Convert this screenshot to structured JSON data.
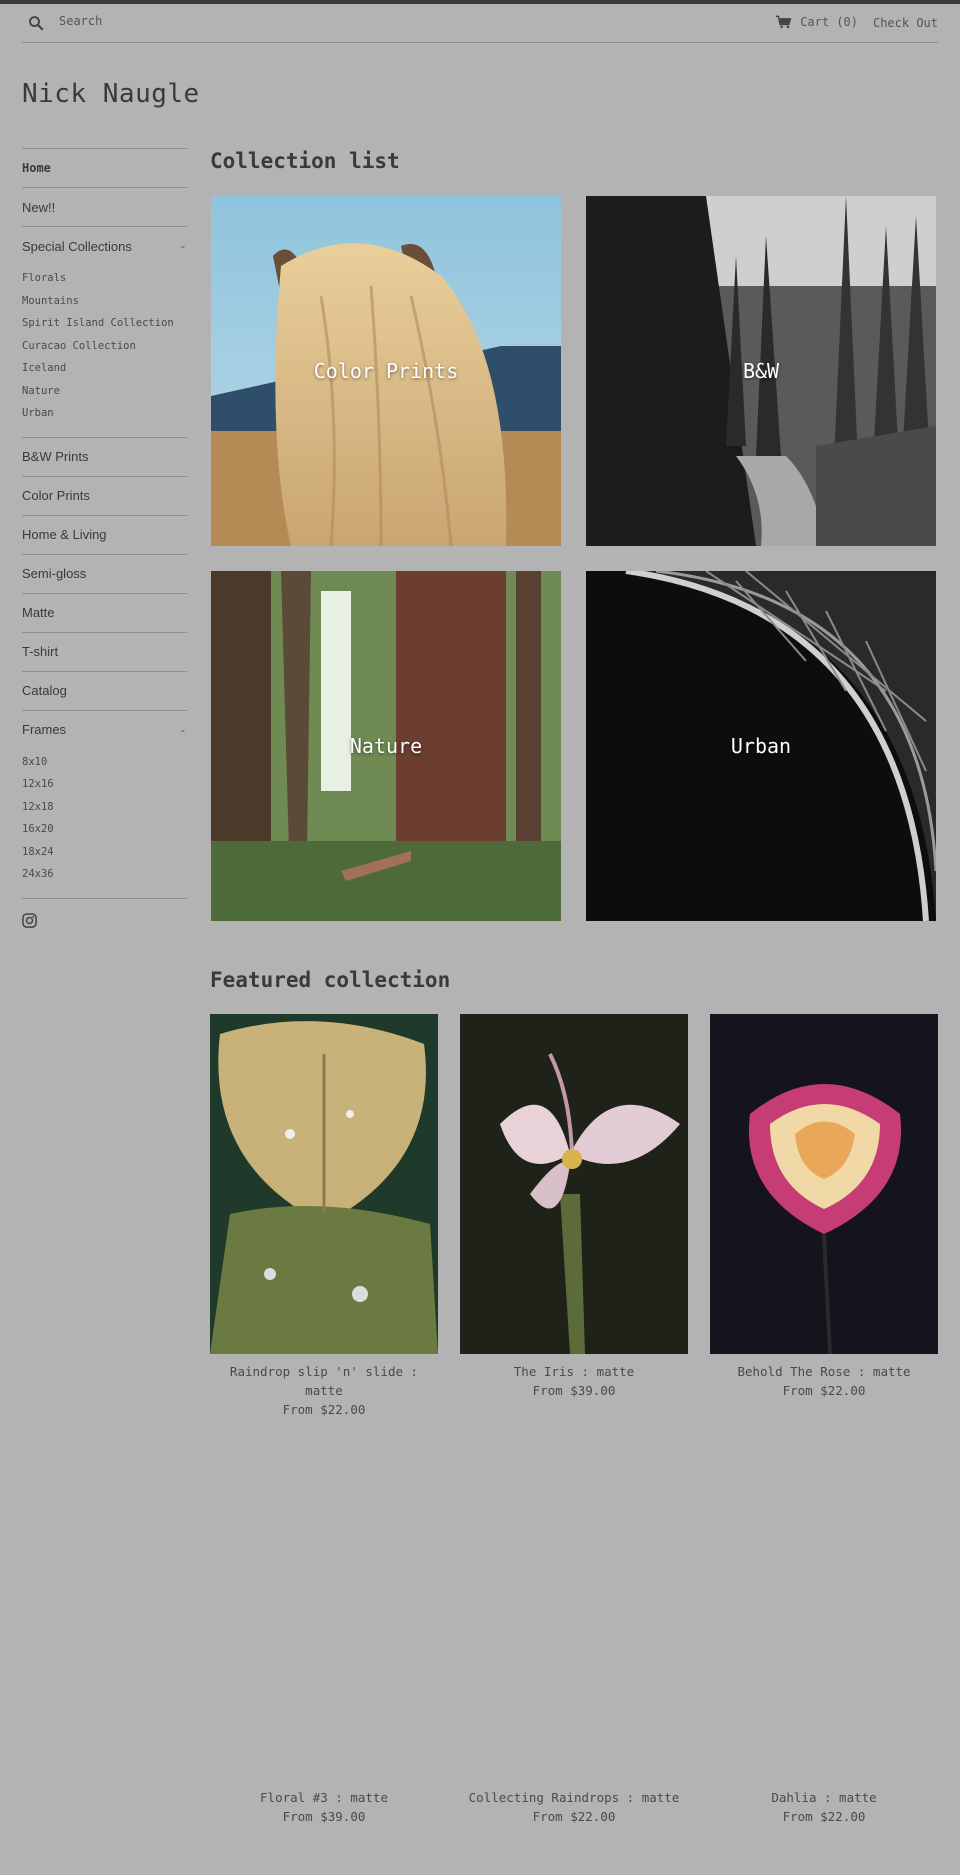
{
  "header": {
    "search_placeholder": "Search",
    "cart_label": "Cart (0)",
    "checkout_label": "Check Out"
  },
  "site": {
    "title": "Nick Naugle"
  },
  "sidebar": {
    "items": [
      {
        "label": "Home"
      },
      {
        "label": "New!!"
      },
      {
        "label": "Special Collections",
        "toggle": "-"
      },
      {
        "label": "B&W Prints"
      },
      {
        "label": "Color Prints"
      },
      {
        "label": "Home & Living"
      },
      {
        "label": "Semi-gloss"
      },
      {
        "label": "Matte"
      },
      {
        "label": "T-shirt"
      },
      {
        "label": "Catalog"
      },
      {
        "label": "Frames",
        "toggle": "-"
      }
    ],
    "special_collections": [
      "Florals",
      "Mountains",
      "Spirit Island Collection",
      "Curacao Collection",
      "Iceland",
      "Nature",
      "Urban"
    ],
    "frames": [
      "8x10",
      "12x16",
      "12x18",
      "16x20",
      "18x24",
      "24x36"
    ]
  },
  "collection_list": {
    "title": "Collection list",
    "tiles": [
      {
        "label": "Color Prints"
      },
      {
        "label": "B&W"
      },
      {
        "label": "Nature"
      },
      {
        "label": "Urban"
      }
    ]
  },
  "featured": {
    "title": "Featured collection",
    "products": [
      {
        "name": "Raindrop slip 'n' slide : matte",
        "price": "From $22.00"
      },
      {
        "name": "The Iris : matte",
        "price": "From $39.00"
      },
      {
        "name": "Behold The Rose : matte",
        "price": "From $22.00"
      },
      {
        "name": "Floral #3 : matte",
        "price": "From $39.00"
      },
      {
        "name": "Collecting Raindrops : matte",
        "price": "From $22.00"
      },
      {
        "name": "Dahlia : matte",
        "price": "From $22.00"
      }
    ]
  }
}
